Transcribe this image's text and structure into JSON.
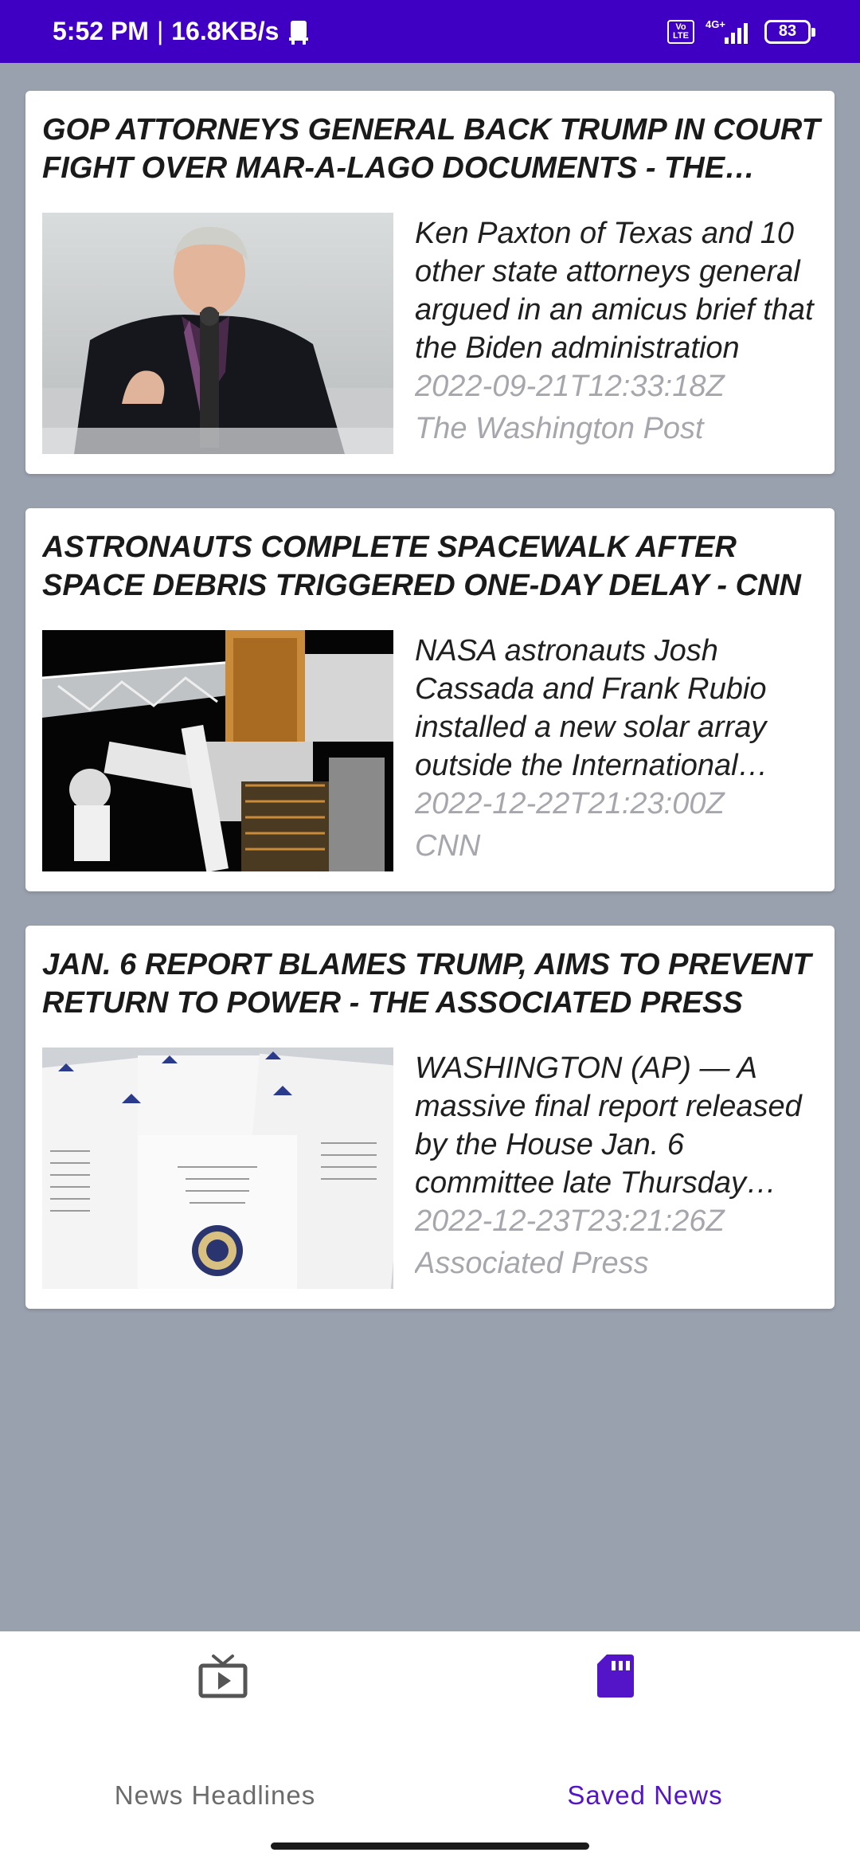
{
  "status_bar": {
    "time": "5:52 PM",
    "separator": "|",
    "speed": "16.8KB/s",
    "volte_top": "Vo",
    "volte_bottom": "LTE",
    "network": "4G+",
    "battery": "83"
  },
  "articles": [
    {
      "title": "GOP ATTORNEYS GENERAL BACK TRUMP IN COURT FIGHT OVER MAR-A-LAGO DOCUMENTS - THE WASHINGTON POST",
      "description": "Ken Paxton of Texas and 10 other state attorneys general argued in an amicus brief that the Biden administration",
      "published": "2022-09-21T12:33:18Z",
      "source": "The Washington Post"
    },
    {
      "title": "ASTRONAUTS COMPLETE SPACEWALK AFTER SPACE DEBRIS TRIGGERED ONE-DAY DELAY - CNN",
      "description": "NASA astronauts Josh Cassada and Frank Rubio installed a new solar array outside the International Space Station",
      "published": "2022-12-22T21:23:00Z",
      "source": "CNN"
    },
    {
      "title": "JAN. 6 REPORT BLAMES TRUMP, AIMS TO PREVENT RETURN TO POWER - THE ASSOCIATED PRESS",
      "description": "WASHINGTON (AP) — A massive final report released by the House Jan. 6 committee late Thursday asserts",
      "published": "2022-12-23T23:21:26Z",
      "source": "Associated Press"
    }
  ],
  "bottom_nav": {
    "items": [
      {
        "label": "News Headlines",
        "icon": "tv-icon",
        "active": false
      },
      {
        "label": "Saved News",
        "icon": "sd-card-icon",
        "active": true
      }
    ]
  },
  "colors": {
    "accent": "#5414c8",
    "status_bar": "#3f00c4",
    "inactive": "#6b6b6b",
    "meta": "#a6a6ad"
  }
}
